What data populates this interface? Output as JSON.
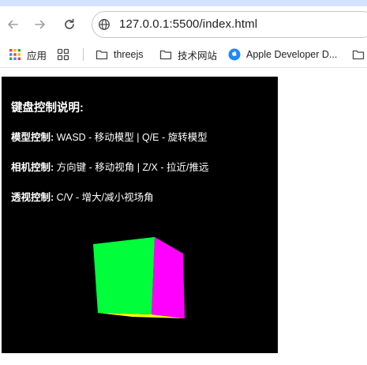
{
  "browser": {
    "url": "127.0.0.1:5500/index.html",
    "bookmarks": [
      {
        "label": "应用",
        "icon": "apps-grid-icon"
      },
      {
        "label": "",
        "icon": "tab-groups-icon"
      },
      {
        "label": "threejs",
        "icon": "folder-icon"
      },
      {
        "label": "技术网站",
        "icon": "folder-icon"
      },
      {
        "label": "Apple Developer D...",
        "icon": "apple-icon"
      },
      {
        "label": "",
        "icon": "folder-icon"
      }
    ]
  },
  "page": {
    "title": "键盘控制说明:",
    "controls": [
      {
        "label": "模型控制:",
        "text": " WASD - 移动模型 | Q/E - 旋转模型"
      },
      {
        "label": "相机控制:",
        "text": " 方向键 - 移动视角 | Z/X - 拉近/推远"
      },
      {
        "label": "透视控制:",
        "text": " C/V - 增大/减小视场角"
      }
    ]
  },
  "colors": {
    "canvas_bg": "#000000",
    "cube_front": "#00ff3a",
    "cube_right": "#ff00ff",
    "cube_bottom": "#ffff00"
  }
}
